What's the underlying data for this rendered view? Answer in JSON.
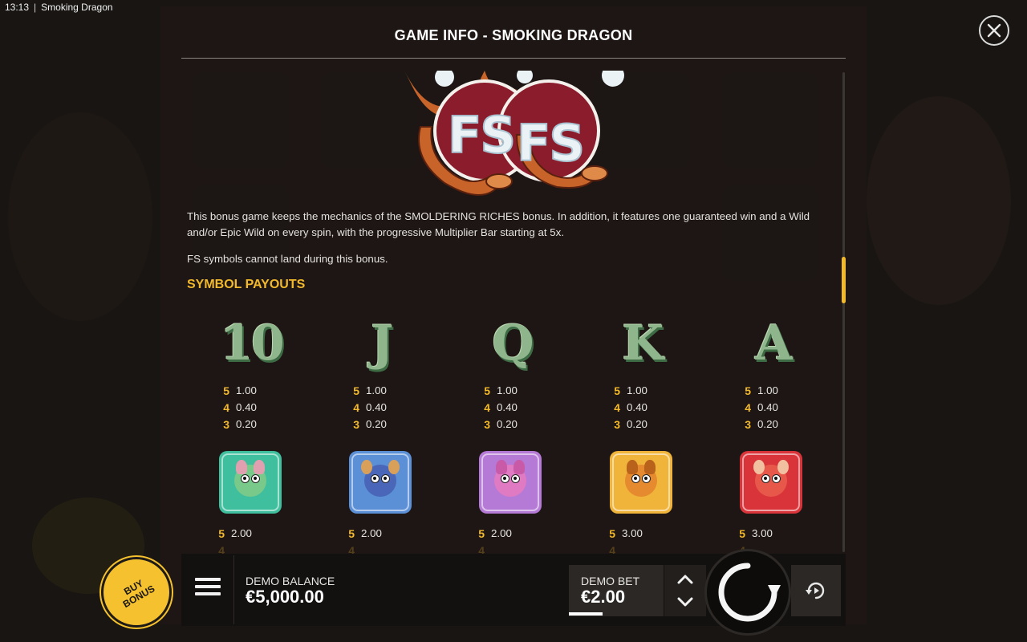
{
  "status_bar": {
    "time": "13:13",
    "separator": "|",
    "app_name": "Smoking Dragon"
  },
  "dialog": {
    "title": "GAME INFO - SMOKING DRAGON",
    "logo_text": "FS",
    "paragraph1": "This bonus game keeps the mechanics of the SMOLDERING RICHES bonus. In addition, it features one guaranteed win and a Wild and/or Epic Wild on every spin, with the progressive Multiplier Bar starting at 5x.",
    "paragraph2": "FS symbols cannot land during this bonus.",
    "section_heading": "SYMBOL PAYOUTS",
    "symbols_row1": [
      {
        "label": "10",
        "icon": "ten-symbol-icon",
        "pays": [
          [
            "5",
            "1.00"
          ],
          [
            "4",
            "0.40"
          ],
          [
            "3",
            "0.20"
          ]
        ]
      },
      {
        "label": "J",
        "icon": "jack-symbol-icon",
        "pays": [
          [
            "5",
            "1.00"
          ],
          [
            "4",
            "0.40"
          ],
          [
            "3",
            "0.20"
          ]
        ]
      },
      {
        "label": "Q",
        "icon": "queen-symbol-icon",
        "pays": [
          [
            "5",
            "1.00"
          ],
          [
            "4",
            "0.40"
          ],
          [
            "3",
            "0.20"
          ]
        ]
      },
      {
        "label": "K",
        "icon": "king-symbol-icon",
        "pays": [
          [
            "5",
            "1.00"
          ],
          [
            "4",
            "0.40"
          ],
          [
            "3",
            "0.20"
          ]
        ]
      },
      {
        "label": "A",
        "icon": "ace-symbol-icon",
        "pays": [
          [
            "5",
            "1.00"
          ],
          [
            "4",
            "0.40"
          ],
          [
            "3",
            "0.20"
          ]
        ]
      }
    ],
    "symbols_row2": [
      {
        "icon": "rabbit-symbol-icon",
        "card_color": "#3fbf9e",
        "face_color": "#79c98a",
        "pay": [
          "5",
          "2.00"
        ]
      },
      {
        "icon": "ram-symbol-icon",
        "card_color": "#5b8fd6",
        "face_color": "#4a66b8",
        "pay": [
          "5",
          "2.00"
        ]
      },
      {
        "icon": "pig-symbol-icon",
        "card_color": "#b57ad6",
        "face_color": "#e07ac2",
        "pay": [
          "5",
          "2.00"
        ]
      },
      {
        "icon": "dog-symbol-icon",
        "card_color": "#f0b43a",
        "face_color": "#e58a2e",
        "pay": [
          "5",
          "3.00"
        ]
      },
      {
        "icon": "monkey-symbol-icon",
        "card_color": "#d9343a",
        "face_color": "#e8584a",
        "pay": [
          "5",
          "3.00"
        ]
      }
    ]
  },
  "bottom_bar": {
    "buy_bonus_label": "BUY BONUS",
    "balance_label": "DEMO BALANCE",
    "balance_value": "€5,000.00",
    "bet_label": "DEMO BET",
    "bet_value": "€2.00"
  },
  "colors": {
    "accent": "#f2b92b",
    "panel_bg": "#131110",
    "text": "#e8e6e3"
  }
}
